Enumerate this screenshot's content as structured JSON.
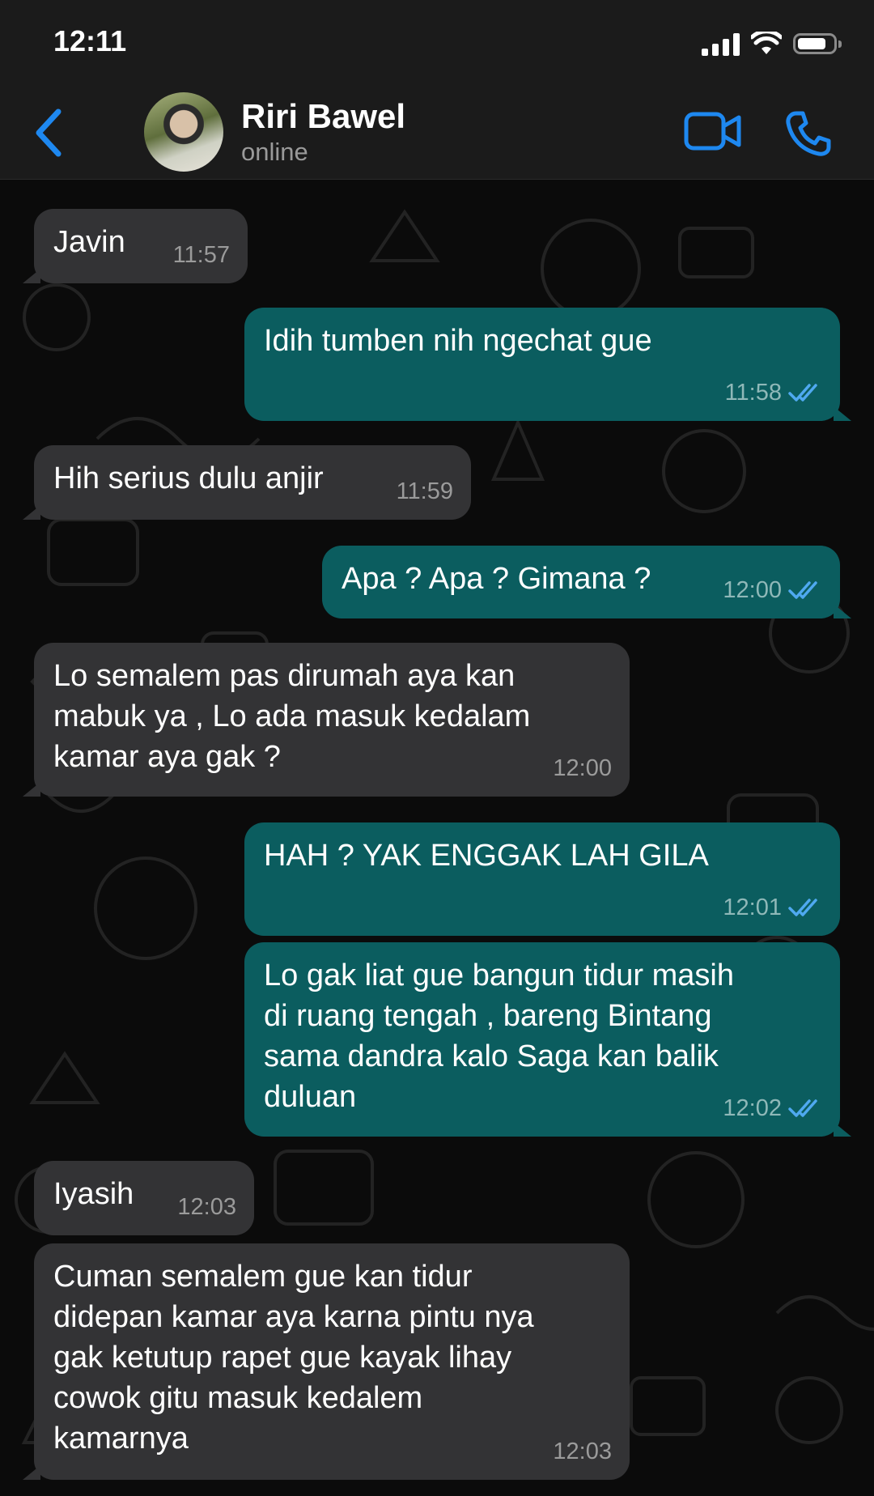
{
  "status_bar": {
    "time": "12:11"
  },
  "header": {
    "contact_name": "Riri Bawel",
    "contact_status": "online"
  },
  "messages": [
    {
      "direction": "incoming",
      "text": "Javin",
      "time": "11:57"
    },
    {
      "direction": "outgoing",
      "text": "Idih tumben nih ngechat gue",
      "time": "11:58",
      "read": true
    },
    {
      "direction": "incoming",
      "text": "Hih serius dulu anjir",
      "time": "11:59"
    },
    {
      "direction": "outgoing",
      "text": "Apa ? Apa ? Gimana ?",
      "time": "12:00",
      "read": true
    },
    {
      "direction": "incoming",
      "text": "Lo semalem pas dirumah aya kan\nmabuk ya , Lo ada masuk kedalam\nkamar aya gak ?",
      "time": "12:00"
    },
    {
      "direction": "outgoing",
      "text": "HAH ? YAK ENGGAK LAH GILA",
      "time": "12:01",
      "read": true
    },
    {
      "direction": "outgoing",
      "text": "Lo gak liat gue bangun tidur masih\ndi ruang tengah , bareng Bintang\nsama dandra kalo Saga kan balik\nduluan",
      "time": "12:02",
      "read": true
    },
    {
      "direction": "incoming",
      "text": "Iyasih",
      "time": "12:03"
    },
    {
      "direction": "incoming",
      "text": "Cuman semalem gue kan tidur\ndidepan kamar aya karna pintu nya\ngak ketutup rapet gue kayak lihay\ncowok gitu masuk kedalem\nkamarnya",
      "time": "12:03"
    }
  ],
  "colors": {
    "incoming_bubble": "#333335",
    "outgoing_bubble": "#0b5d5f",
    "accent": "#1e88f0",
    "read_tick": "#4fa9f0"
  }
}
